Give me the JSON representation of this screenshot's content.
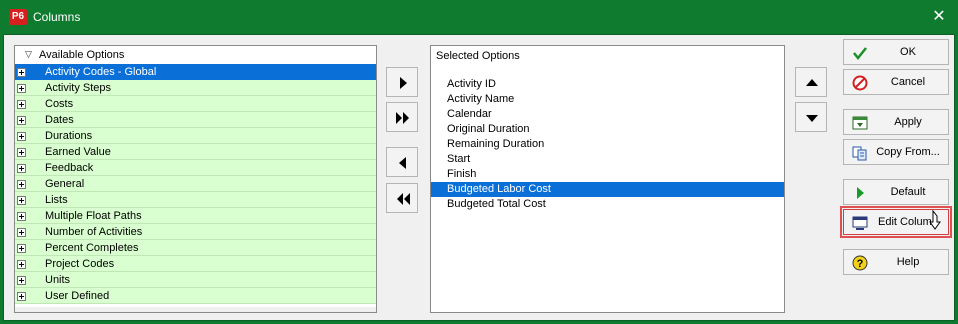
{
  "window": {
    "title": "Columns",
    "app_badge": "P6"
  },
  "available": {
    "header": "Available Options",
    "items": [
      {
        "label": "Activity Codes - Global",
        "selected": true
      },
      {
        "label": "Activity Steps"
      },
      {
        "label": "Costs"
      },
      {
        "label": "Dates"
      },
      {
        "label": "Durations"
      },
      {
        "label": "Earned Value"
      },
      {
        "label": "Feedback"
      },
      {
        "label": "General"
      },
      {
        "label": "Lists"
      },
      {
        "label": "Multiple Float Paths"
      },
      {
        "label": "Number of Activities"
      },
      {
        "label": "Percent Completes"
      },
      {
        "label": "Project Codes"
      },
      {
        "label": "Units"
      },
      {
        "label": "User Defined"
      }
    ]
  },
  "selected": {
    "header": "Selected Options",
    "items": [
      {
        "label": "Activity ID"
      },
      {
        "label": "Activity Name"
      },
      {
        "label": "Calendar"
      },
      {
        "label": "Original Duration"
      },
      {
        "label": "Remaining Duration"
      },
      {
        "label": "Start"
      },
      {
        "label": "Finish"
      },
      {
        "label": "Budgeted Labor Cost",
        "selected": true
      },
      {
        "label": "Budgeted Total Cost"
      }
    ]
  },
  "buttons": {
    "ok": "OK",
    "cancel": "Cancel",
    "apply": "Apply",
    "copy_from": "Copy From...",
    "default": "Default",
    "edit_column": "Edit Column",
    "help": "Help"
  },
  "colors": {
    "title_bar": "#0f7b2f",
    "selection": "#0a6fd6",
    "available_row": "#d9ffd0",
    "highlight_outline": "#e05050"
  }
}
